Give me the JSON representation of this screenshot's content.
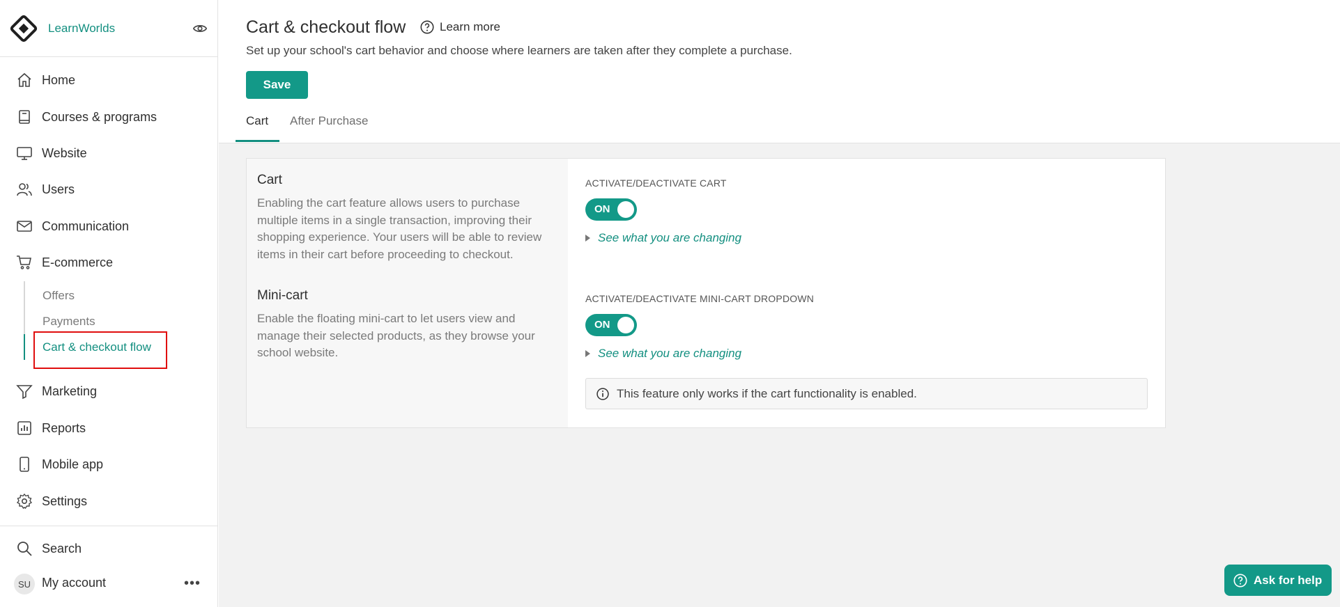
{
  "sidebar": {
    "brand": "LearnWorlds",
    "items": [
      {
        "label": "Home",
        "icon": "home-icon"
      },
      {
        "label": "Courses & programs",
        "icon": "book-icon"
      },
      {
        "label": "Website",
        "icon": "monitor-icon"
      },
      {
        "label": "Users",
        "icon": "users-icon"
      },
      {
        "label": "Communication",
        "icon": "mail-icon"
      },
      {
        "label": "E-commerce",
        "icon": "cart-icon"
      },
      {
        "label": "Marketing",
        "icon": "funnel-icon"
      },
      {
        "label": "Reports",
        "icon": "chart-icon"
      },
      {
        "label": "Mobile app",
        "icon": "phone-icon"
      },
      {
        "label": "Settings",
        "icon": "gear-icon"
      }
    ],
    "ecommerce_sub": [
      {
        "label": "Offers"
      },
      {
        "label": "Payments"
      },
      {
        "label": "Cart & checkout flow",
        "active": true
      }
    ],
    "search_label": "Search",
    "account_initials": "SU",
    "account_label": "My account",
    "more_label": "•••"
  },
  "header": {
    "title": "Cart & checkout flow",
    "learn_more": "Learn more",
    "subtitle": "Set up your school's cart behavior and choose where learners are taken after they complete a purchase.",
    "save_label": "Save",
    "tabs": [
      {
        "label": "Cart",
        "active": true
      },
      {
        "label": "After Purchase",
        "active": false
      }
    ]
  },
  "cart_section": {
    "title": "Cart",
    "description": "Enabling the cart feature allows users to purchase multiple items in a single transaction, improving their shopping experience. Your users will be able to review items in their cart before proceeding to checkout.",
    "field_label": "ACTIVATE/DEACTIVATE CART",
    "toggle_label": "ON",
    "see_changes": "See what you are changing"
  },
  "minicart_section": {
    "title": "Mini-cart",
    "description": "Enable the floating mini-cart to let users view and manage their selected products, as they browse your school website.",
    "field_label": "ACTIVATE/DEACTIVATE MINI-CART DROPDOWN",
    "toggle_label": "ON",
    "see_changes": "See what you are changing",
    "info": "This feature only works if the cart functionality is enabled."
  },
  "help_button": "Ask for help",
  "colors": {
    "accent": "#139988",
    "highlight": "#e00d0d"
  }
}
